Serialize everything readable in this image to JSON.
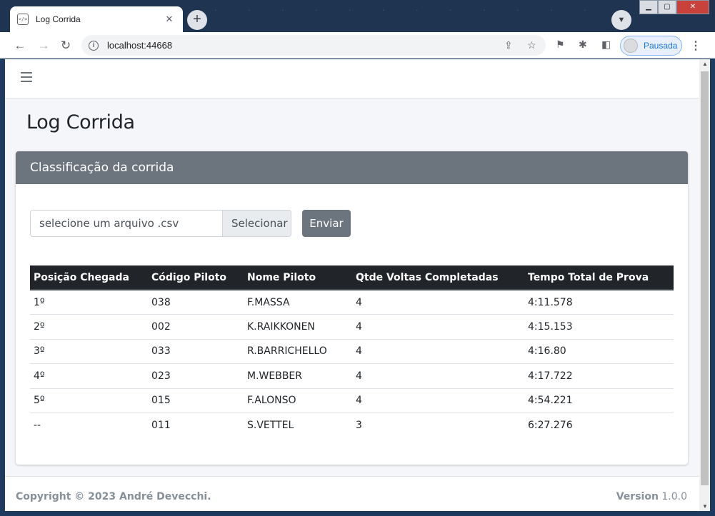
{
  "browser": {
    "tab_title": "Log Corrida",
    "url": "localhost:44668",
    "profile_label": "Pausada",
    "new_tab_symbol": "+",
    "tab_close_symbol": "✕",
    "menu_symbol": "⋮"
  },
  "page": {
    "title": "Log Corrida"
  },
  "card": {
    "header": "Classificação da corrida",
    "file_placeholder": "selecione um arquivo .csv",
    "select_label": "Selecionar",
    "send_label": "Enviar"
  },
  "table": {
    "headers": [
      "Posição Chegada",
      "Código Piloto",
      "Nome Piloto",
      "Qtde Voltas Completadas",
      "Tempo Total de Prova"
    ],
    "rows": [
      [
        "1º",
        "038",
        "F.MASSA",
        "4",
        "4:11.578"
      ],
      [
        "2º",
        "002",
        "K.RAIKKONEN",
        "4",
        "4:15.153"
      ],
      [
        "3º",
        "033",
        "R.BARRICHELLO",
        "4",
        "4:16.80"
      ],
      [
        "4º",
        "023",
        "M.WEBBER",
        "4",
        "4:17.722"
      ],
      [
        "5º",
        "015",
        "F.ALONSO",
        "4",
        "4:54.221"
      ],
      [
        "--",
        "011",
        "S.VETTEL",
        "3",
        "6:27.276"
      ]
    ]
  },
  "footer": {
    "copyright": "Copyright © 2023 André Devecchi.",
    "version_label": "Version",
    "version_number": "1.0.0"
  },
  "colors": {
    "card_header": "#6c757d",
    "table_header": "#212529",
    "page_bg": "#f4f6f9"
  }
}
